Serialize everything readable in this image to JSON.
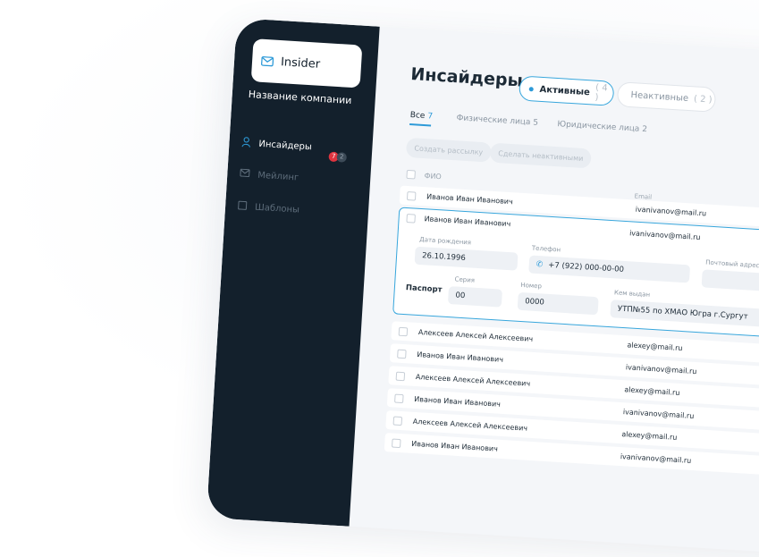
{
  "app": {
    "logo_text": "Insider",
    "company_name": "Название компании"
  },
  "sidebar": {
    "items": [
      {
        "label": "Инсайдеры",
        "icon": "user-icon",
        "active": true
      },
      {
        "label": "Мейлинг",
        "icon": "mail-icon",
        "active": false
      },
      {
        "label": "Шаблоны",
        "icon": "template-icon",
        "active": false
      }
    ],
    "badges": {
      "red": "7",
      "grey": "2"
    }
  },
  "header": {
    "title": "Инсайдеры",
    "status_filters": [
      {
        "label": "Активные",
        "count": "( 4 )"
      },
      {
        "label": "Неактивные",
        "count": "( 2 )"
      }
    ]
  },
  "tabs": [
    {
      "label": "Все",
      "count": "7"
    },
    {
      "label": "Физические лица",
      "count": "5"
    },
    {
      "label": "Юридические лица",
      "count": "2"
    }
  ],
  "actions": {
    "create_mailing": "Создать рассылку",
    "make_inactive": "Сделать неактивными"
  },
  "table": {
    "col_name": "ФИО",
    "col_email": "Email",
    "expanded": {
      "name": "Иванов Иван Иванович",
      "email": "ivanivanov@mail.ru",
      "birth_label": "Дата рождения",
      "birth_value": "26.10.1996",
      "phone_label": "Телефон",
      "phone_value": "+7 (922) 000-00-00",
      "address_label": "Почтовый адрес",
      "passport_label": "Паспорт",
      "series_label": "Серия",
      "series_value": "00",
      "number_label": "Номер",
      "number_value": "0000",
      "issued_label": "Кем выдан",
      "issued_value": "УТП№55 по ХМАО Югра г.Сургут"
    },
    "rows": [
      {
        "name": "Иванов Иван Иванович",
        "email": ""
      },
      {
        "name": "Алексеев Алексей Алексеевич",
        "email": "alexey@mail.ru"
      },
      {
        "name": "Иванов Иван Иванович",
        "email": "ivanivanov@mail.ru"
      },
      {
        "name": "Алексеев Алексей Алексеевич",
        "email": "alexey@mail.ru"
      },
      {
        "name": "Иванов Иван Иванович",
        "email": "ivanivanov@mail.ru"
      },
      {
        "name": "Алексеев Алексей Алексеевич",
        "email": "alexey@mail.ru"
      },
      {
        "name": "Иванов Иван Иванович",
        "email": "ivanivanov@mail.ru"
      }
    ],
    "first_row_email": "ivanivanov@mail.ru"
  },
  "colors": {
    "sidebar_bg": "#13202c",
    "accent": "#2d9ad8",
    "badge_red": "#e0343f"
  }
}
